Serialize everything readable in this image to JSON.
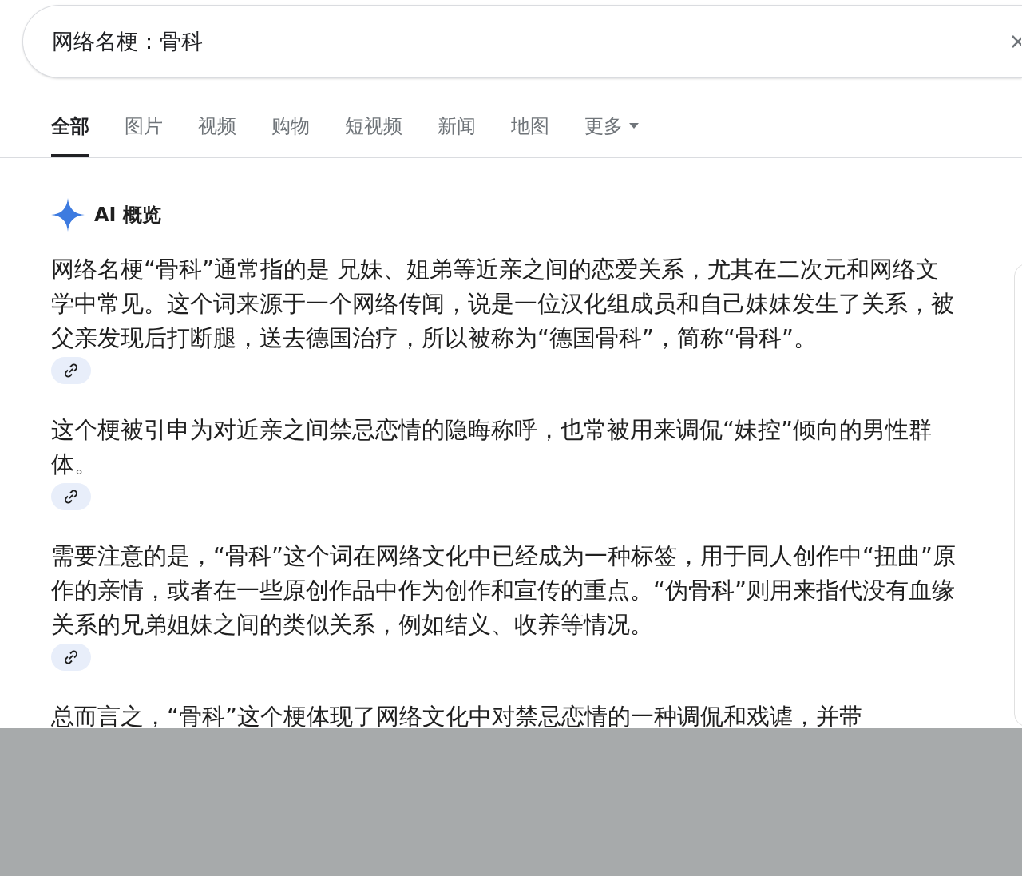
{
  "search": {
    "value": "网络名梗：骨科"
  },
  "tabs": [
    {
      "label": "全部",
      "selected": true
    },
    {
      "label": "图片",
      "selected": false
    },
    {
      "label": "视频",
      "selected": false
    },
    {
      "label": "购物",
      "selected": false
    },
    {
      "label": "短视频",
      "selected": false
    },
    {
      "label": "新闻",
      "selected": false
    },
    {
      "label": "地图",
      "selected": false
    },
    {
      "label": "更多",
      "selected": false,
      "kind": "menu"
    }
  ],
  "ai_overview": {
    "title": "AI 概览",
    "paragraphs": [
      {
        "text": "网络名梗“骨科”通常指的是 兄妹、姐弟等近亲之间的恋爱关系，尤其在二次元和网络文学中常见。这个词来源于一个网络传闻，说是一位汉化组成员和自己妹妹发生了关系，被父亲发现后打断腿，送去德国治疗，所以被称为“德国骨科”，简称“骨科”。",
        "link": true
      },
      {
        "text": "这个梗被引申为对近亲之间禁忌恋情的隐晦称呼，也常被用来调侃“妹控”倾向的男性群体。",
        "link": true
      },
      {
        "text": "需要注意的是，“骨科”这个词在网络文化中已经成为一种标签，用于同人创作中“扭曲”原作的亲情，或者在一些原创作品中作为创作和宣传的重点。“伪骨科”则用来指代没有血缘关系的兄弟姐妹之间的类似关系，例如结义、收养等情况。",
        "link": true
      },
      {
        "text": "总而言之，“骨科”这个梗体现了网络文化中对禁忌恋情的一种调侃和戏谑，并带",
        "link": false
      }
    ]
  }
}
